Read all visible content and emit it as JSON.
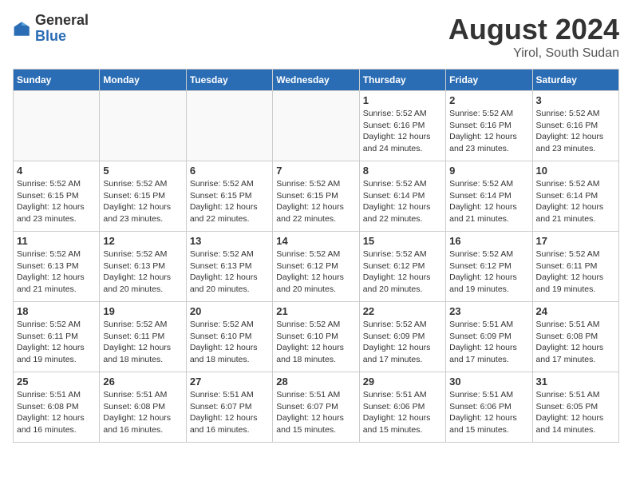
{
  "header": {
    "logo_general": "General",
    "logo_blue": "Blue",
    "month_title": "August 2024",
    "location": "Yirol, South Sudan"
  },
  "weekdays": [
    "Sunday",
    "Monday",
    "Tuesday",
    "Wednesday",
    "Thursday",
    "Friday",
    "Saturday"
  ],
  "weeks": [
    [
      {
        "day": "",
        "info": ""
      },
      {
        "day": "",
        "info": ""
      },
      {
        "day": "",
        "info": ""
      },
      {
        "day": "",
        "info": ""
      },
      {
        "day": "1",
        "info": "Sunrise: 5:52 AM\nSunset: 6:16 PM\nDaylight: 12 hours\nand 24 minutes."
      },
      {
        "day": "2",
        "info": "Sunrise: 5:52 AM\nSunset: 6:16 PM\nDaylight: 12 hours\nand 23 minutes."
      },
      {
        "day": "3",
        "info": "Sunrise: 5:52 AM\nSunset: 6:16 PM\nDaylight: 12 hours\nand 23 minutes."
      }
    ],
    [
      {
        "day": "4",
        "info": "Sunrise: 5:52 AM\nSunset: 6:15 PM\nDaylight: 12 hours\nand 23 minutes."
      },
      {
        "day": "5",
        "info": "Sunrise: 5:52 AM\nSunset: 6:15 PM\nDaylight: 12 hours\nand 23 minutes."
      },
      {
        "day": "6",
        "info": "Sunrise: 5:52 AM\nSunset: 6:15 PM\nDaylight: 12 hours\nand 22 minutes."
      },
      {
        "day": "7",
        "info": "Sunrise: 5:52 AM\nSunset: 6:15 PM\nDaylight: 12 hours\nand 22 minutes."
      },
      {
        "day": "8",
        "info": "Sunrise: 5:52 AM\nSunset: 6:14 PM\nDaylight: 12 hours\nand 22 minutes."
      },
      {
        "day": "9",
        "info": "Sunrise: 5:52 AM\nSunset: 6:14 PM\nDaylight: 12 hours\nand 21 minutes."
      },
      {
        "day": "10",
        "info": "Sunrise: 5:52 AM\nSunset: 6:14 PM\nDaylight: 12 hours\nand 21 minutes."
      }
    ],
    [
      {
        "day": "11",
        "info": "Sunrise: 5:52 AM\nSunset: 6:13 PM\nDaylight: 12 hours\nand 21 minutes."
      },
      {
        "day": "12",
        "info": "Sunrise: 5:52 AM\nSunset: 6:13 PM\nDaylight: 12 hours\nand 20 minutes."
      },
      {
        "day": "13",
        "info": "Sunrise: 5:52 AM\nSunset: 6:13 PM\nDaylight: 12 hours\nand 20 minutes."
      },
      {
        "day": "14",
        "info": "Sunrise: 5:52 AM\nSunset: 6:12 PM\nDaylight: 12 hours\nand 20 minutes."
      },
      {
        "day": "15",
        "info": "Sunrise: 5:52 AM\nSunset: 6:12 PM\nDaylight: 12 hours\nand 20 minutes."
      },
      {
        "day": "16",
        "info": "Sunrise: 5:52 AM\nSunset: 6:12 PM\nDaylight: 12 hours\nand 19 minutes."
      },
      {
        "day": "17",
        "info": "Sunrise: 5:52 AM\nSunset: 6:11 PM\nDaylight: 12 hours\nand 19 minutes."
      }
    ],
    [
      {
        "day": "18",
        "info": "Sunrise: 5:52 AM\nSunset: 6:11 PM\nDaylight: 12 hours\nand 19 minutes."
      },
      {
        "day": "19",
        "info": "Sunrise: 5:52 AM\nSunset: 6:11 PM\nDaylight: 12 hours\nand 18 minutes."
      },
      {
        "day": "20",
        "info": "Sunrise: 5:52 AM\nSunset: 6:10 PM\nDaylight: 12 hours\nand 18 minutes."
      },
      {
        "day": "21",
        "info": "Sunrise: 5:52 AM\nSunset: 6:10 PM\nDaylight: 12 hours\nand 18 minutes."
      },
      {
        "day": "22",
        "info": "Sunrise: 5:52 AM\nSunset: 6:09 PM\nDaylight: 12 hours\nand 17 minutes."
      },
      {
        "day": "23",
        "info": "Sunrise: 5:51 AM\nSunset: 6:09 PM\nDaylight: 12 hours\nand 17 minutes."
      },
      {
        "day": "24",
        "info": "Sunrise: 5:51 AM\nSunset: 6:08 PM\nDaylight: 12 hours\nand 17 minutes."
      }
    ],
    [
      {
        "day": "25",
        "info": "Sunrise: 5:51 AM\nSunset: 6:08 PM\nDaylight: 12 hours\nand 16 minutes."
      },
      {
        "day": "26",
        "info": "Sunrise: 5:51 AM\nSunset: 6:08 PM\nDaylight: 12 hours\nand 16 minutes."
      },
      {
        "day": "27",
        "info": "Sunrise: 5:51 AM\nSunset: 6:07 PM\nDaylight: 12 hours\nand 16 minutes."
      },
      {
        "day": "28",
        "info": "Sunrise: 5:51 AM\nSunset: 6:07 PM\nDaylight: 12 hours\nand 15 minutes."
      },
      {
        "day": "29",
        "info": "Sunrise: 5:51 AM\nSunset: 6:06 PM\nDaylight: 12 hours\nand 15 minutes."
      },
      {
        "day": "30",
        "info": "Sunrise: 5:51 AM\nSunset: 6:06 PM\nDaylight: 12 hours\nand 15 minutes."
      },
      {
        "day": "31",
        "info": "Sunrise: 5:51 AM\nSunset: 6:05 PM\nDaylight: 12 hours\nand 14 minutes."
      }
    ]
  ]
}
